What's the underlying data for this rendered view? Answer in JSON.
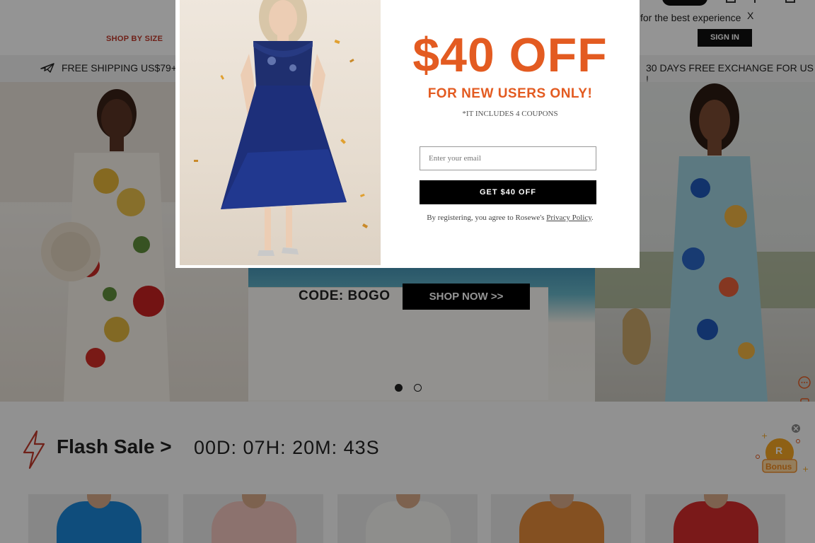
{
  "header": {
    "nav_shop_by_size": "SHOP BY SIZE",
    "app_note": "for the best experience",
    "app_close": "X",
    "sign_in": "SIGN IN"
  },
  "promo_bar": {
    "free_shipping": "FREE SHIPPING US$79+",
    "exchange": "30 DAYS FREE EXCHANGE FOR US !"
  },
  "hero": {
    "code": "CODE: BOGO",
    "shop_now": "SHOP NOW >>",
    "slides": 2,
    "active_slide": 1
  },
  "flash_sale": {
    "title": "Flash Sale >",
    "countdown": "00D: 07H: 20M: 43S"
  },
  "bonus": {
    "label": "Bonus",
    "badge": "R"
  },
  "modal": {
    "offer": "$40 OFF",
    "subtitle": "FOR NEW USERS ONLY!",
    "coupons_note": "*IT INCLUDES 4 COUPONS",
    "email_placeholder": "Enter your email",
    "email_value": "",
    "submit": "GET $40 OFF",
    "legal_prefix": "By registering, you agree to Rosewe's ",
    "legal_link": "Privacy Policy",
    "legal_suffix": "."
  },
  "colors": {
    "accent_orange": "#e35b21",
    "overlay": "rgba(0,0,0,0.42)",
    "dark_button": "#000000"
  }
}
